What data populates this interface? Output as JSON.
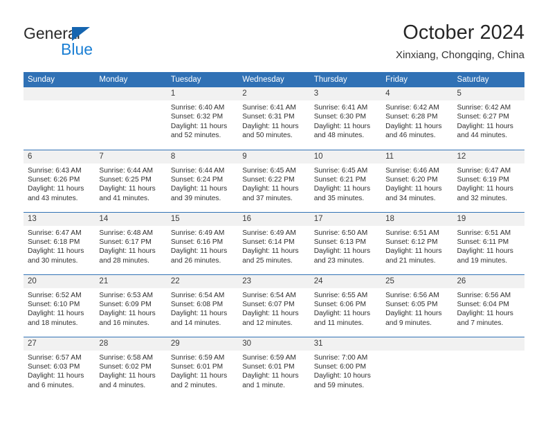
{
  "brand": {
    "name_part1": "General",
    "name_part2": "Blue",
    "triangle_color": "#1565b0",
    "blue_text_color": "#1b7fd4"
  },
  "header": {
    "title": "October 2024",
    "location": "Xinxiang, Chongqing, China"
  },
  "theme": {
    "header_blue": "#3071b5",
    "daynum_band": "#f1f1f1",
    "text": "#2e2e2e"
  },
  "weekday_headers": [
    "Sunday",
    "Monday",
    "Tuesday",
    "Wednesday",
    "Thursday",
    "Friday",
    "Saturday"
  ],
  "labels": {
    "sunrise_prefix": "Sunrise:",
    "sunset_prefix": "Sunset:",
    "daylight_prefix": "Daylight:"
  },
  "weeks": [
    [
      {
        "day": "",
        "empty": true,
        "line1": "",
        "line2": "",
        "line3": "",
        "line4": ""
      },
      {
        "day": "",
        "empty": true,
        "line1": "",
        "line2": "",
        "line3": "",
        "line4": ""
      },
      {
        "day": "1",
        "line1": "Sunrise: 6:40 AM",
        "line2": "Sunset: 6:32 PM",
        "line3": "Daylight: 11 hours",
        "line4": "and 52 minutes."
      },
      {
        "day": "2",
        "line1": "Sunrise: 6:41 AM",
        "line2": "Sunset: 6:31 PM",
        "line3": "Daylight: 11 hours",
        "line4": "and 50 minutes."
      },
      {
        "day": "3",
        "line1": "Sunrise: 6:41 AM",
        "line2": "Sunset: 6:30 PM",
        "line3": "Daylight: 11 hours",
        "line4": "and 48 minutes."
      },
      {
        "day": "4",
        "line1": "Sunrise: 6:42 AM",
        "line2": "Sunset: 6:28 PM",
        "line3": "Daylight: 11 hours",
        "line4": "and 46 minutes."
      },
      {
        "day": "5",
        "line1": "Sunrise: 6:42 AM",
        "line2": "Sunset: 6:27 PM",
        "line3": "Daylight: 11 hours",
        "line4": "and 44 minutes."
      }
    ],
    [
      {
        "day": "6",
        "line1": "Sunrise: 6:43 AM",
        "line2": "Sunset: 6:26 PM",
        "line3": "Daylight: 11 hours",
        "line4": "and 43 minutes."
      },
      {
        "day": "7",
        "line1": "Sunrise: 6:44 AM",
        "line2": "Sunset: 6:25 PM",
        "line3": "Daylight: 11 hours",
        "line4": "and 41 minutes."
      },
      {
        "day": "8",
        "line1": "Sunrise: 6:44 AM",
        "line2": "Sunset: 6:24 PM",
        "line3": "Daylight: 11 hours",
        "line4": "and 39 minutes."
      },
      {
        "day": "9",
        "line1": "Sunrise: 6:45 AM",
        "line2": "Sunset: 6:22 PM",
        "line3": "Daylight: 11 hours",
        "line4": "and 37 minutes."
      },
      {
        "day": "10",
        "line1": "Sunrise: 6:45 AM",
        "line2": "Sunset: 6:21 PM",
        "line3": "Daylight: 11 hours",
        "line4": "and 35 minutes."
      },
      {
        "day": "11",
        "line1": "Sunrise: 6:46 AM",
        "line2": "Sunset: 6:20 PM",
        "line3": "Daylight: 11 hours",
        "line4": "and 34 minutes."
      },
      {
        "day": "12",
        "line1": "Sunrise: 6:47 AM",
        "line2": "Sunset: 6:19 PM",
        "line3": "Daylight: 11 hours",
        "line4": "and 32 minutes."
      }
    ],
    [
      {
        "day": "13",
        "line1": "Sunrise: 6:47 AM",
        "line2": "Sunset: 6:18 PM",
        "line3": "Daylight: 11 hours",
        "line4": "and 30 minutes."
      },
      {
        "day": "14",
        "line1": "Sunrise: 6:48 AM",
        "line2": "Sunset: 6:17 PM",
        "line3": "Daylight: 11 hours",
        "line4": "and 28 minutes."
      },
      {
        "day": "15",
        "line1": "Sunrise: 6:49 AM",
        "line2": "Sunset: 6:16 PM",
        "line3": "Daylight: 11 hours",
        "line4": "and 26 minutes."
      },
      {
        "day": "16",
        "line1": "Sunrise: 6:49 AM",
        "line2": "Sunset: 6:14 PM",
        "line3": "Daylight: 11 hours",
        "line4": "and 25 minutes."
      },
      {
        "day": "17",
        "line1": "Sunrise: 6:50 AM",
        "line2": "Sunset: 6:13 PM",
        "line3": "Daylight: 11 hours",
        "line4": "and 23 minutes."
      },
      {
        "day": "18",
        "line1": "Sunrise: 6:51 AM",
        "line2": "Sunset: 6:12 PM",
        "line3": "Daylight: 11 hours",
        "line4": "and 21 minutes."
      },
      {
        "day": "19",
        "line1": "Sunrise: 6:51 AM",
        "line2": "Sunset: 6:11 PM",
        "line3": "Daylight: 11 hours",
        "line4": "and 19 minutes."
      }
    ],
    [
      {
        "day": "20",
        "line1": "Sunrise: 6:52 AM",
        "line2": "Sunset: 6:10 PM",
        "line3": "Daylight: 11 hours",
        "line4": "and 18 minutes."
      },
      {
        "day": "21",
        "line1": "Sunrise: 6:53 AM",
        "line2": "Sunset: 6:09 PM",
        "line3": "Daylight: 11 hours",
        "line4": "and 16 minutes."
      },
      {
        "day": "22",
        "line1": "Sunrise: 6:54 AM",
        "line2": "Sunset: 6:08 PM",
        "line3": "Daylight: 11 hours",
        "line4": "and 14 minutes."
      },
      {
        "day": "23",
        "line1": "Sunrise: 6:54 AM",
        "line2": "Sunset: 6:07 PM",
        "line3": "Daylight: 11 hours",
        "line4": "and 12 minutes."
      },
      {
        "day": "24",
        "line1": "Sunrise: 6:55 AM",
        "line2": "Sunset: 6:06 PM",
        "line3": "Daylight: 11 hours",
        "line4": "and 11 minutes."
      },
      {
        "day": "25",
        "line1": "Sunrise: 6:56 AM",
        "line2": "Sunset: 6:05 PM",
        "line3": "Daylight: 11 hours",
        "line4": "and 9 minutes."
      },
      {
        "day": "26",
        "line1": "Sunrise: 6:56 AM",
        "line2": "Sunset: 6:04 PM",
        "line3": "Daylight: 11 hours",
        "line4": "and 7 minutes."
      }
    ],
    [
      {
        "day": "27",
        "line1": "Sunrise: 6:57 AM",
        "line2": "Sunset: 6:03 PM",
        "line3": "Daylight: 11 hours",
        "line4": "and 6 minutes."
      },
      {
        "day": "28",
        "line1": "Sunrise: 6:58 AM",
        "line2": "Sunset: 6:02 PM",
        "line3": "Daylight: 11 hours",
        "line4": "and 4 minutes."
      },
      {
        "day": "29",
        "line1": "Sunrise: 6:59 AM",
        "line2": "Sunset: 6:01 PM",
        "line3": "Daylight: 11 hours",
        "line4": "and 2 minutes."
      },
      {
        "day": "30",
        "line1": "Sunrise: 6:59 AM",
        "line2": "Sunset: 6:01 PM",
        "line3": "Daylight: 11 hours",
        "line4": "and 1 minute."
      },
      {
        "day": "31",
        "line1": "Sunrise: 7:00 AM",
        "line2": "Sunset: 6:00 PM",
        "line3": "Daylight: 10 hours",
        "line4": "and 59 minutes."
      },
      {
        "day": "",
        "empty": true,
        "line1": "",
        "line2": "",
        "line3": "",
        "line4": ""
      },
      {
        "day": "",
        "empty": true,
        "line1": "",
        "line2": "",
        "line3": "",
        "line4": ""
      }
    ]
  ]
}
